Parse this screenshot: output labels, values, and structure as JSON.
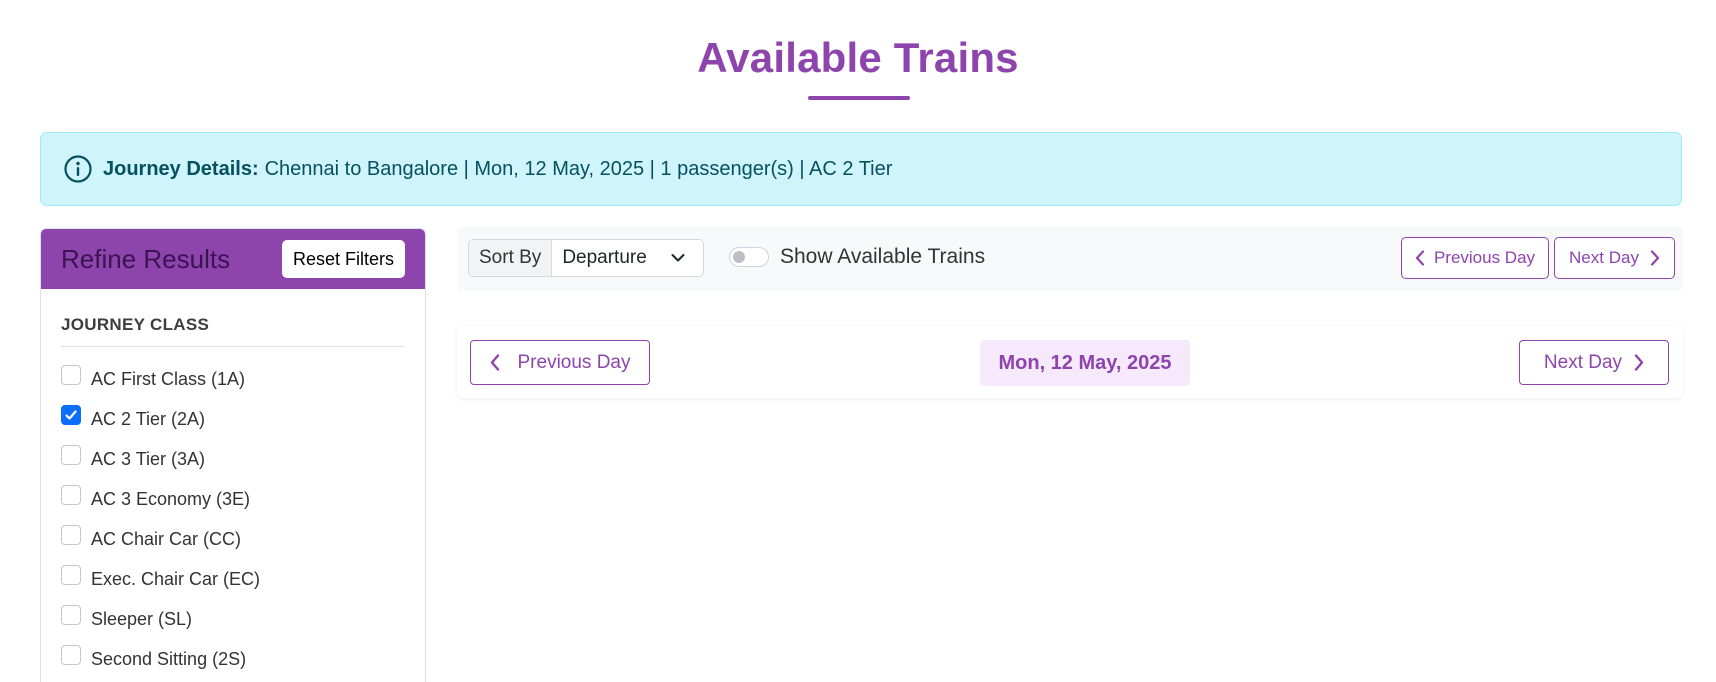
{
  "page": {
    "title": "Available Trains"
  },
  "journey": {
    "label": "Journey Details:",
    "summary": "Chennai to Bangalore | Mon, 12 May, 2025 | 1 passenger(s) | AC 2 Tier",
    "icon": "info-icon"
  },
  "sidebar": {
    "title": "Refine Results",
    "reset_label": "Reset Filters",
    "section_title": "JOURNEY CLASS",
    "classes": [
      {
        "label": "AC First Class (1A)",
        "checked": false
      },
      {
        "label": "AC 2 Tier (2A)",
        "checked": true
      },
      {
        "label": "AC 3 Tier (3A)",
        "checked": false
      },
      {
        "label": "AC 3 Economy (3E)",
        "checked": false
      },
      {
        "label": "AC Chair Car (CC)",
        "checked": false
      },
      {
        "label": "Exec. Chair Car (EC)",
        "checked": false
      },
      {
        "label": "Sleeper (SL)",
        "checked": false
      },
      {
        "label": "Second Sitting (2S)",
        "checked": false
      }
    ]
  },
  "toolbar": {
    "sort_label": "Sort By",
    "sort_value": "Departure",
    "toggle_label": "Show Available Trains",
    "toggle_on": false,
    "prev_label": "Previous Day",
    "next_label": "Next Day"
  },
  "day_nav": {
    "prev_label": "Previous Day",
    "next_label": "Next Day",
    "current_date": "Mon, 12 May, 2025"
  },
  "colors": {
    "primary": "#8e44ad",
    "info_bg": "#cff4fc",
    "info_text": "#055160",
    "checkbox_checked": "#0d6efd"
  }
}
